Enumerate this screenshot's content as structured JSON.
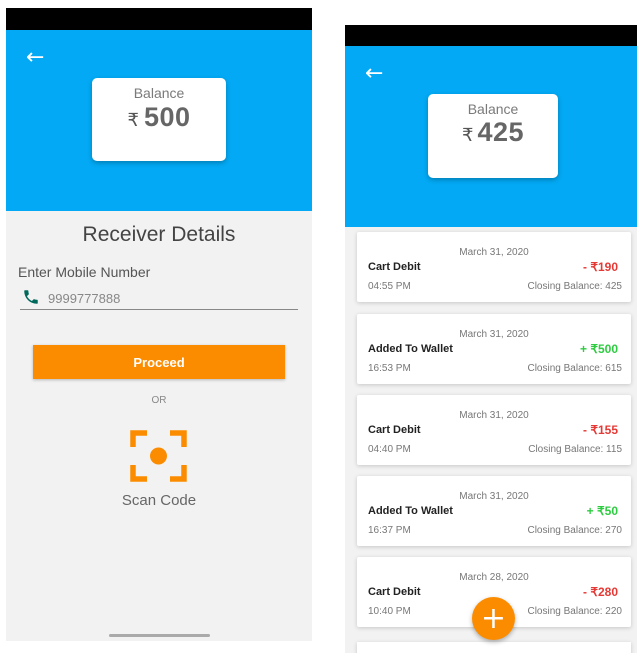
{
  "wallet_screen": {
    "balance_label": "Balance",
    "currency_symbol": "₹",
    "balance_amount": "500",
    "receiver_title": "Receiver Details",
    "mobile_label": "Enter Mobile Number",
    "mobile_value": "9999777888",
    "proceed_label": "Proceed",
    "or_label": "OR",
    "scan_label": "Scan Code",
    "icons": {
      "back": "back-arrow-icon",
      "phone": "phone-icon",
      "scan": "scan-code-icon"
    }
  },
  "history_screen": {
    "balance_label": "Balance",
    "currency_symbol": "₹",
    "balance_amount": "425",
    "transactions": [
      {
        "date": "March 31, 2020",
        "title": "Cart Debit",
        "amount": "- ₹190",
        "type": "debit",
        "time": "04:55 PM",
        "closing": "Closing Balance: 425"
      },
      {
        "date": "March 31, 2020",
        "title": "Added To Wallet",
        "amount": "+ ₹500",
        "type": "credit",
        "time": "16:53 PM",
        "closing": "Closing Balance: 615"
      },
      {
        "date": "March 31, 2020",
        "title": "Cart Debit",
        "amount": "- ₹155",
        "type": "debit",
        "time": "04:40 PM",
        "closing": "Closing Balance: 115"
      },
      {
        "date": "March 31, 2020",
        "title": "Added To Wallet",
        "amount": "+ ₹50",
        "type": "credit",
        "time": "16:37 PM",
        "closing": "Closing Balance: 270"
      },
      {
        "date": "March 28, 2020",
        "title": "Cart Debit",
        "amount": "- ₹280",
        "type": "debit",
        "time": "10:40 PM",
        "closing": "Closing Balance: 220"
      }
    ],
    "fab_symbol": "+",
    "icons": {
      "back": "back-arrow-icon",
      "fab": "add-icon"
    }
  },
  "colors": {
    "header_blue": "#03a9f4",
    "accent_orange": "#fb8c00",
    "debit_red": "#e53935",
    "credit_green": "#2ecc40",
    "phone_icon_teal": "#00695c"
  }
}
